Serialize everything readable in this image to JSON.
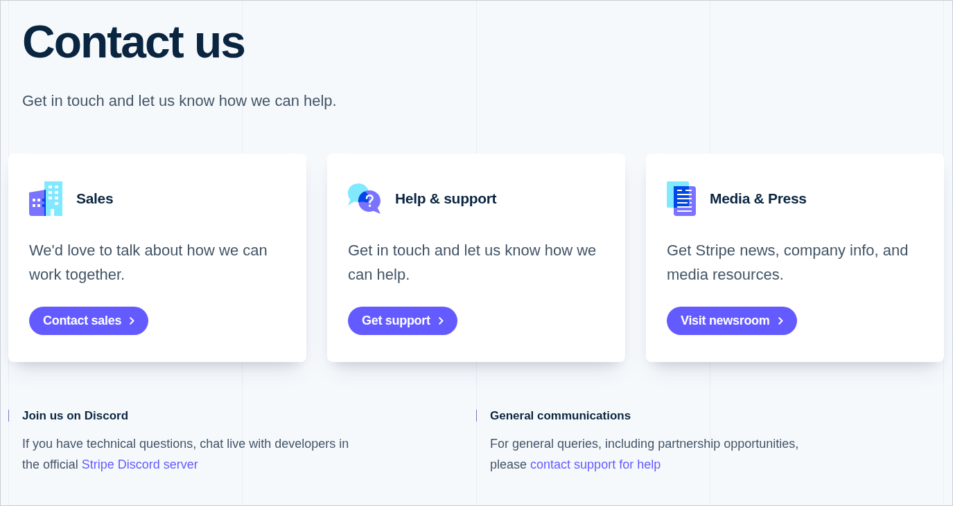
{
  "page": {
    "title": "Contact us",
    "subtitle": "Get in touch and let us know how we can help."
  },
  "cards": [
    {
      "kind": "sales",
      "title": "Sales",
      "description": "We'd love to talk about how we can work together.",
      "button": "Contact sales"
    },
    {
      "kind": "support",
      "title": "Help & support",
      "description": "Get in touch and let us know how we can help.",
      "button": "Get support"
    },
    {
      "kind": "press",
      "title": "Media & Press",
      "description": "Get Stripe news, company info, and media resources.",
      "button": "Visit newsroom"
    }
  ],
  "sections": [
    {
      "heading": "Join us on Discord",
      "text": "If you have technical questions, chat live with developers in the official",
      "link": "Stripe Discord server"
    },
    {
      "heading": "General communications",
      "text": "For general queries, including partnership opportunities, please",
      "link": "contact support for help"
    }
  ]
}
